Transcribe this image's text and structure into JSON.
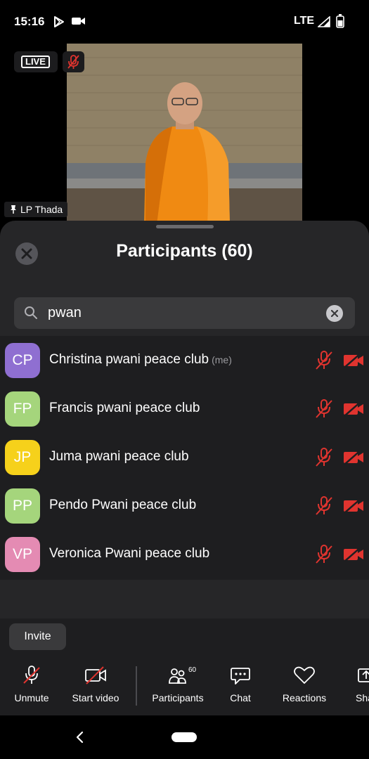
{
  "status_bar": {
    "time": "15:16",
    "network": "LTE"
  },
  "video": {
    "live_label": "LIVE",
    "pinned_name": "LP Thada"
  },
  "participants_panel": {
    "title": "Participants (60)",
    "search": {
      "value": "pwan"
    },
    "participants": [
      {
        "initials": "CP",
        "name": "Christina pwani peace club",
        "suffix": "(me)",
        "color": "#8f6fd1",
        "muted": true,
        "video_off": true
      },
      {
        "initials": "FP",
        "name": "Francis pwani peace club",
        "suffix": "",
        "color": "#a5d57c",
        "muted": true,
        "video_off": true
      },
      {
        "initials": "JP",
        "name": "Juma pwani peace club",
        "suffix": "",
        "color": "#f6d11b",
        "muted": true,
        "video_off": true
      },
      {
        "initials": "PP",
        "name": "Pendo Pwani peace club",
        "suffix": "",
        "color": "#a5d57c",
        "muted": true,
        "video_off": true
      },
      {
        "initials": "VP",
        "name": "Veronica Pwani peace club",
        "suffix": "",
        "color": "#e48bb3",
        "muted": true,
        "video_off": true
      }
    ],
    "invite_label": "Invite"
  },
  "toolbar": {
    "unmute": "Unmute",
    "start_video": "Start video",
    "participants": "Participants",
    "participants_count": "60",
    "chat": "Chat",
    "reactions": "Reactions",
    "share": "Sha"
  },
  "colors": {
    "muted_red": "#e0342f",
    "sheet_bg": "#262628",
    "list_bg": "#1e1e20"
  }
}
